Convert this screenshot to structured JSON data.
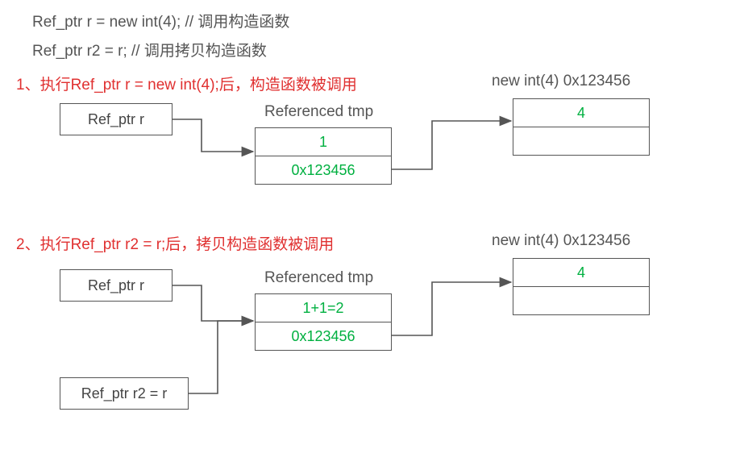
{
  "code": {
    "line1": "Ref_ptr r = new int(4);  // 调用构造函数",
    "line2": "Ref_ptr r2 = r;  // 调用拷贝构造函数"
  },
  "step1": {
    "title": "1、执行Ref_ptr r = new int(4);后，构造函数被调用",
    "ptr_r": "Ref_ptr r",
    "referenced_label": "Referenced tmp",
    "count": "1",
    "addr": "0x123456",
    "heap_label": "new int(4) 0x123456",
    "heap_value": "4"
  },
  "step2": {
    "title": "2、执行Ref_ptr r2 = r;后，拷贝构造函数被调用",
    "ptr_r": "Ref_ptr r",
    "ptr_r2": "Ref_ptr r2 = r",
    "referenced_label": "Referenced tmp",
    "count": "1+1=2",
    "addr": "0x123456",
    "heap_label": "new int(4) 0x123456",
    "heap_value": "4"
  }
}
